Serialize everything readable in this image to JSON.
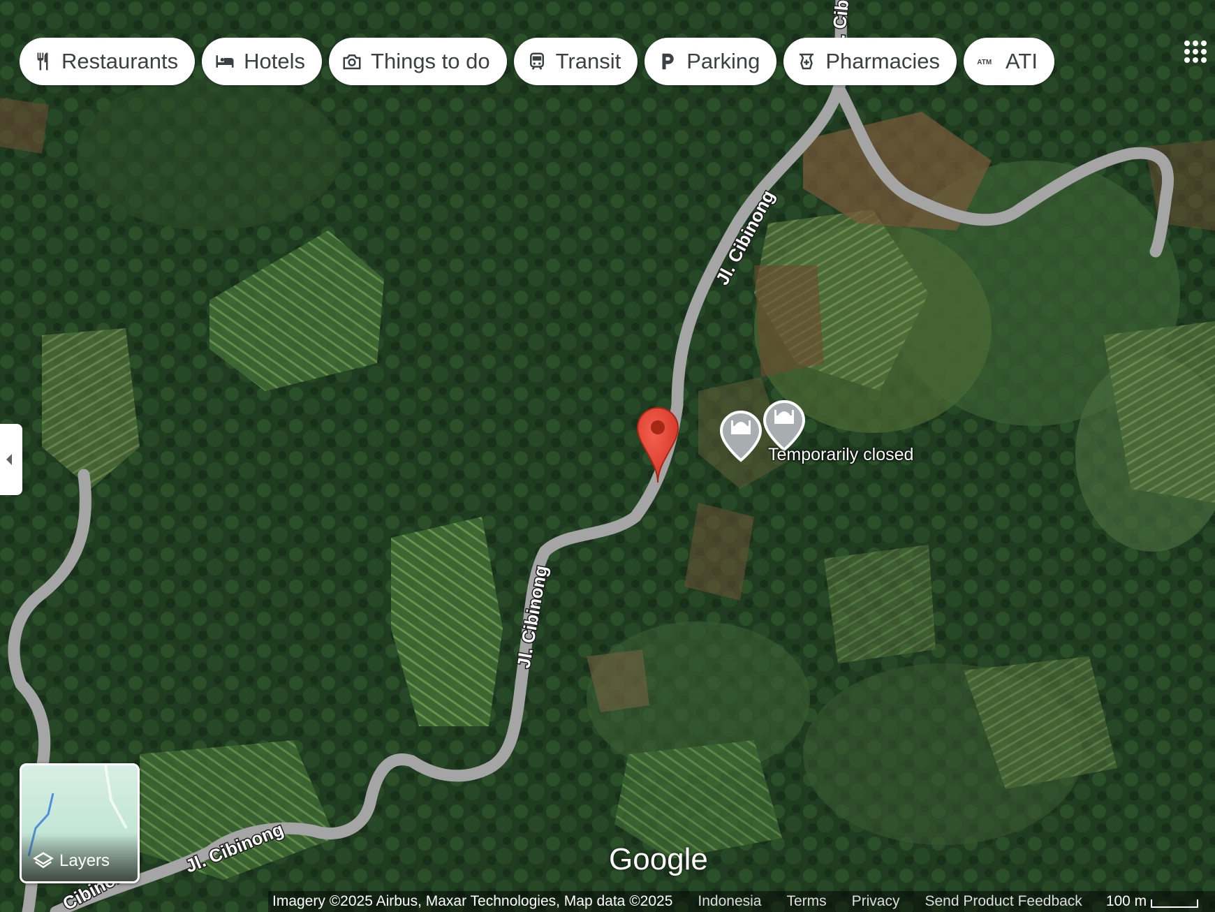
{
  "categories": [
    {
      "label": "Restaurants",
      "icon": "fork-knife-icon"
    },
    {
      "label": "Hotels",
      "icon": "bed-icon"
    },
    {
      "label": "Things to do",
      "icon": "camera-icon"
    },
    {
      "label": "Transit",
      "icon": "train-icon"
    },
    {
      "label": "Parking",
      "icon": "parking-icon"
    },
    {
      "label": "Pharmacies",
      "icon": "pharmacy-icon"
    },
    {
      "label": "ATI",
      "icon": "atm-icon"
    }
  ],
  "map": {
    "road_labels": [
      "Jl. Cibinong",
      "Jl. Cibinong",
      "Jl. Cibinong",
      "Jl. Cibin",
      "Cibinong"
    ],
    "poi_label": "Temporarily closed",
    "marker_color": "#ea4335",
    "poi_pin_color": "#a8adb0",
    "road_color": "#a5a5a5",
    "brand": "Google"
  },
  "layers": {
    "label": "Layers"
  },
  "footer": {
    "attribution": "Imagery ©2025 Airbus, Maxar Technologies, Map data ©2025",
    "country": "Indonesia",
    "terms": "Terms",
    "privacy": "Privacy",
    "feedback": "Send Product Feedback",
    "scale": "100 m"
  }
}
